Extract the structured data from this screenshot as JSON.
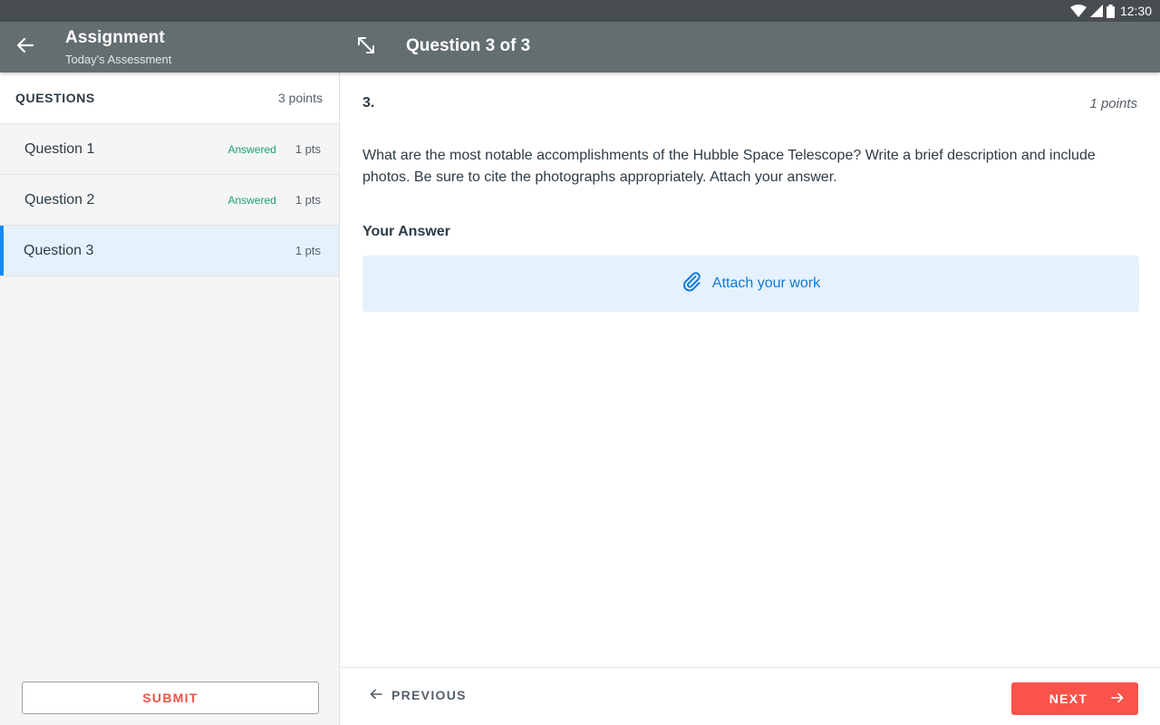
{
  "status_bar": {
    "time": "12:30",
    "icons": [
      "wifi-icon",
      "signal-icon",
      "battery-icon"
    ]
  },
  "app_bar": {
    "title": "Assignment",
    "subtitle": "Today's Assessment",
    "question_header": "Question 3 of 3",
    "icons": [
      "arrow-back-icon",
      "expand-icon"
    ]
  },
  "sidebar": {
    "header_title": "QUESTIONS",
    "header_points": "3 points",
    "items": [
      {
        "label": "Question 1",
        "status": "Answered",
        "pts": "1 pts"
      },
      {
        "label": "Question 2",
        "status": "Answered",
        "pts": "1 pts"
      },
      {
        "label": "Question 3",
        "status": "",
        "pts": "1 pts"
      }
    ],
    "submit_label": "SUBMIT"
  },
  "question": {
    "number": "3.",
    "points": "1 points",
    "text": "What are the most notable accomplishments of the Hubble Space Telescope? Write a brief description and include photos. Be sure to cite the photographs appropriately. Attach your answer.",
    "answer_label": "Your Answer",
    "attach_label": "Attach your work"
  },
  "footer": {
    "previous_label": "PREVIOUS",
    "next_label": "NEXT"
  },
  "colors": {
    "app_bar": "#636e6f",
    "status_bar": "#474c4f",
    "accent": "#1589f2",
    "answered": "#1a9e79",
    "danger": "#f9534a"
  }
}
